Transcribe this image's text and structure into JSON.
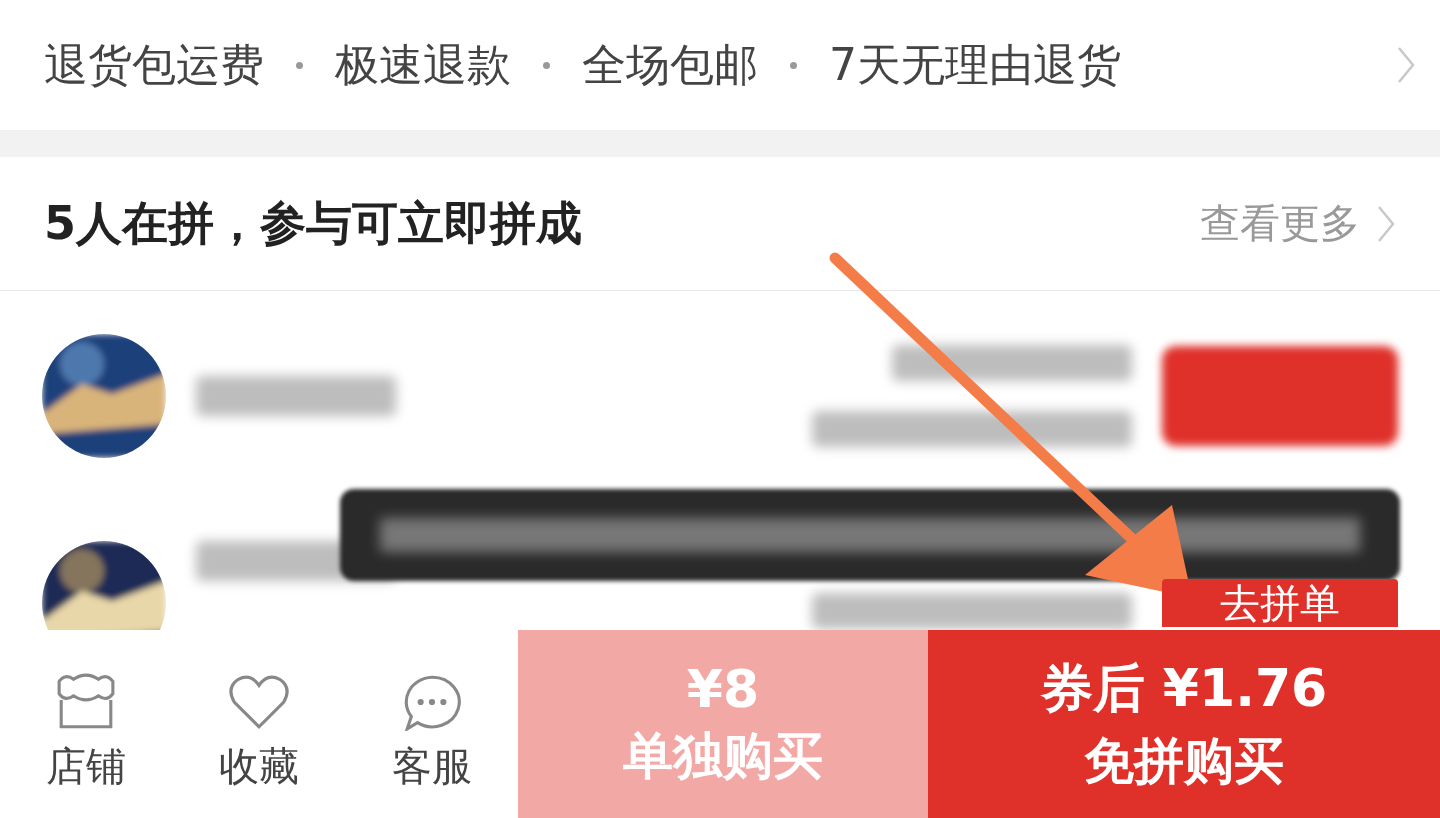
{
  "services": [
    "退货包运费",
    "极速退款",
    "全场包邮",
    "7天无理由退货"
  ],
  "group_section": {
    "title": "5人在拼，参与可立即拼成",
    "more_link": "查看更多"
  },
  "groups": [
    {
      "kind": "blurred"
    },
    {
      "kind": "partial",
      "button": "去拼单"
    }
  ],
  "tooltip": {
    "kind": "blurred"
  },
  "bottom_bar": {
    "icons": [
      {
        "kind": "shop",
        "label": "店铺"
      },
      {
        "kind": "favorite",
        "label": "收藏"
      },
      {
        "kind": "chat",
        "label": "客服"
      }
    ],
    "buttons": [
      {
        "kind": "solo",
        "price": "¥8",
        "label": "单独购买"
      },
      {
        "kind": "group",
        "price": "券后 ¥1.76",
        "label": "免拼购买"
      }
    ]
  },
  "annotation": {
    "kind": "arrow"
  }
}
